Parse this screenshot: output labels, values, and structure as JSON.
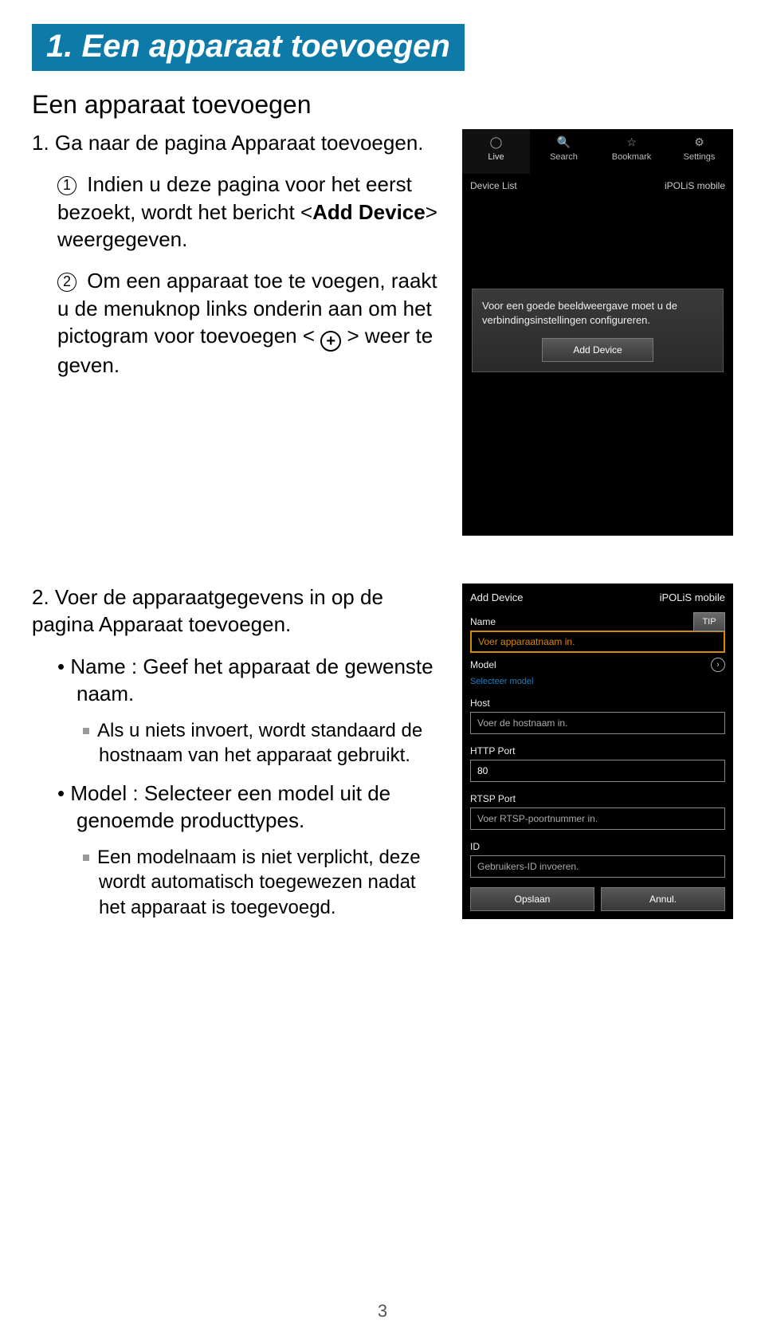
{
  "header": {
    "section_title": "1. Een apparaat toevoegen",
    "subtitle": "Een apparaat toevoegen"
  },
  "step1": {
    "intro": "1. Ga naar de pagina Apparaat toevoegen.",
    "sub1_pre": "Indien u deze pagina voor het eerst bezoekt, wordt het bericht <",
    "sub1_bold": "Add Device",
    "sub1_post": "> weergegeven.",
    "sub2_pre": "Om een apparaat toe te voegen, raakt u de menuknop links onderin aan om het pictogram voor toevoegen < ",
    "sub2_post": " > weer te geven."
  },
  "phone1": {
    "tabs": [
      "Live",
      "Search",
      "Bookmark",
      "Settings"
    ],
    "bar_left": "Device List",
    "bar_right": "iPOLiS mobile",
    "dialog_text": "Voor een goede beeldweergave moet u de verbindingsinstellingen configureren.",
    "button": "Add Device"
  },
  "step2": {
    "intro": "2. Voer de apparaatgegevens in op de pagina Apparaat toevoegen.",
    "bullet_name": "Name : Geef het apparaat de gewenste naam.",
    "bullet_name_sub": "Als u niets invoert, wordt standaard de hostnaam van het apparaat gebruikt.",
    "bullet_model": "Model : Selecteer een model uit de genoemde producttypes.",
    "bullet_model_sub": "Een modelnaam is niet verplicht, deze wordt automatisch toegewezen nadat het apparaat is toegevoegd."
  },
  "phone2": {
    "header_left": "Add Device",
    "header_right": "iPOLiS mobile",
    "tip": "TIP",
    "labels": {
      "name": "Name",
      "model": "Model",
      "model_sel": "Selecteer model",
      "host": "Host",
      "http": "HTTP Port",
      "rtsp": "RTSP Port",
      "id": "ID"
    },
    "placeholders": {
      "name": "Voer apparaatnaam in.",
      "host": "Voer de hostnaam in.",
      "http": "80",
      "rtsp": "Voer RTSP-poortnummer in.",
      "id": "Gebruikers-ID invoeren."
    },
    "buttons": {
      "save": "Opslaan",
      "cancel": "Annul."
    }
  },
  "page_number": "3"
}
